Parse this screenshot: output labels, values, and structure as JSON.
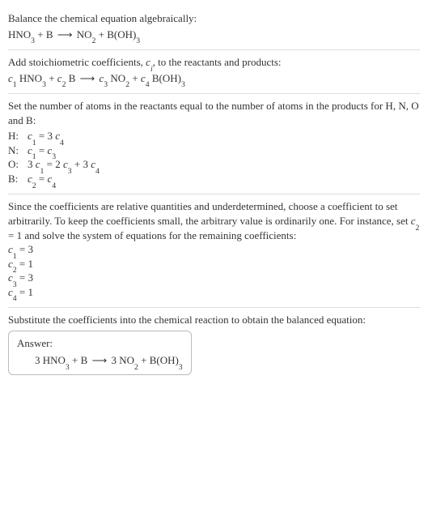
{
  "step1": {
    "intro": "Balance the chemical equation algebraically:",
    "equation": "HNO₃ + B ⟶ NO₂ + B(OH)₃"
  },
  "step2": {
    "intro_a": "Add stoichiometric coefficients, ",
    "intro_var": "c",
    "intro_sub": "i",
    "intro_b": ", to the reactants and products:",
    "equation_parts": {
      "c1": "c",
      "s1": "1",
      "sp1": " HNO",
      "sub_hno3": "3",
      "plus1": " + ",
      "c2": "c",
      "s2": "2",
      "sp2": " B ",
      "arrow": "⟶",
      "sp3": " ",
      "c3": "c",
      "s3": "3",
      "sp4": " NO",
      "sub_no2": "2",
      "plus2": " + ",
      "c4": "c",
      "s4": "4",
      "sp5": " B(OH)",
      "sub_boh3": "3"
    }
  },
  "step3": {
    "intro": "Set the number of atoms in the reactants equal to the number of atoms in the products for H, N, O and B:",
    "rows": [
      {
        "label": "H:",
        "eq": "c₁ = 3 c₄"
      },
      {
        "label": "N:",
        "eq": "c₁ = c₃"
      },
      {
        "label": "O:",
        "eq": "3 c₁ = 2 c₃ + 3 c₄"
      },
      {
        "label": "B:",
        "eq": "c₂ = c₄"
      }
    ]
  },
  "step4": {
    "intro": "Since the coefficients are relative quantities and underdetermined, choose a coefficient to set arbitrarily. To keep the coefficients small, the arbitrary value is ordinarily one. For instance, set c₂ = 1 and solve the system of equations for the remaining coefficients:",
    "coeffs": [
      "c₁ = 3",
      "c₂ = 1",
      "c₃ = 3",
      "c₄ = 1"
    ]
  },
  "step5": {
    "intro": "Substitute the coefficients into the chemical reaction to obtain the balanced equation:",
    "answer_label": "Answer:",
    "answer_eq": "3 HNO₃ + B ⟶ 3 NO₂ + B(OH)₃"
  }
}
